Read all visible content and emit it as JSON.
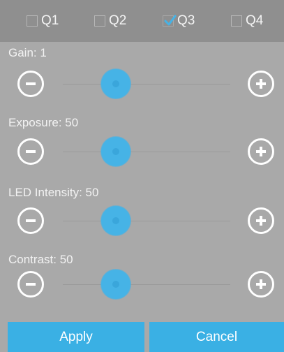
{
  "tabs": [
    {
      "label": "Q1",
      "checked": false
    },
    {
      "label": "Q2",
      "checked": false
    },
    {
      "label": "Q3",
      "checked": true
    },
    {
      "label": "Q4",
      "checked": false
    }
  ],
  "sliders": [
    {
      "label": "Gain: 1",
      "value": 1
    },
    {
      "label": "Exposure: 50",
      "value": 50
    },
    {
      "label": "LED Intensity: 50",
      "value": 50
    },
    {
      "label": "Contrast: 50",
      "value": 50
    }
  ],
  "buttons": {
    "apply": "Apply",
    "cancel": "Cancel"
  },
  "icons": {
    "decrease": "minus-circle-icon",
    "increase": "plus-circle-icon",
    "check": "check-icon"
  },
  "colors": {
    "accent": "#3ab0e4",
    "thumb": "#46b3e6",
    "background": "#a9a9a9",
    "tabbar": "#8f8f8f",
    "text": "#ffffff"
  }
}
